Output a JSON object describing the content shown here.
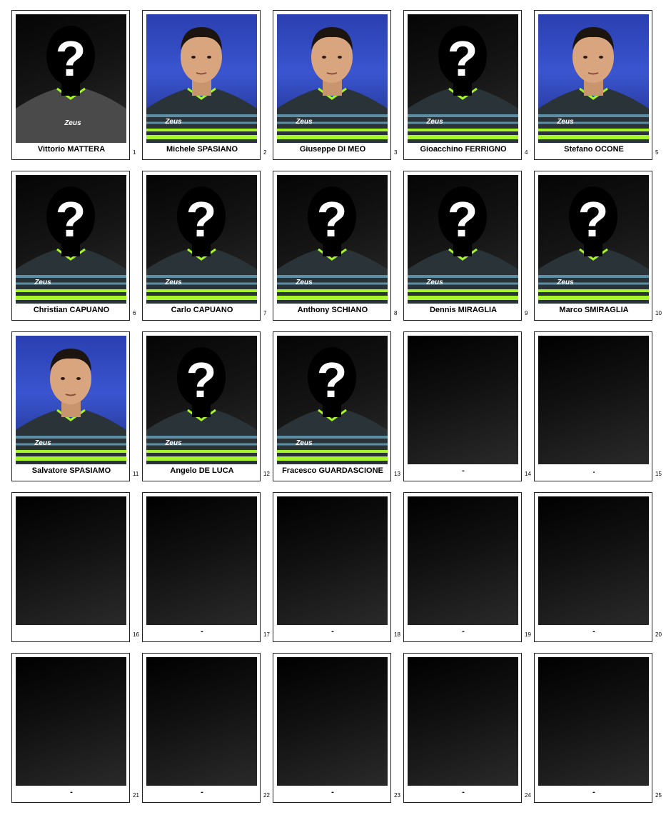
{
  "cards": [
    {
      "number": "1",
      "name": "Vittorio MATTERA",
      "photo": "silhouette-placeholder-grey-kit"
    },
    {
      "number": "2",
      "name": "Michele SPASIANO",
      "photo": "player-portrait"
    },
    {
      "number": "3",
      "name": "Giuseppe DI MEO",
      "photo": "player-portrait"
    },
    {
      "number": "4",
      "name": "Gioacchino FERRIGNO",
      "photo": "silhouette-placeholder"
    },
    {
      "number": "5",
      "name": "Stefano OCONE",
      "photo": "player-portrait"
    },
    {
      "number": "6",
      "name": "Christian CAPUANO",
      "photo": "silhouette-placeholder"
    },
    {
      "number": "7",
      "name": "Carlo CAPUANO",
      "photo": "silhouette-placeholder"
    },
    {
      "number": "8",
      "name": "Anthony SCHIANO",
      "photo": "silhouette-placeholder"
    },
    {
      "number": "9",
      "name": "Dennis MIRAGLIA",
      "photo": "silhouette-placeholder"
    },
    {
      "number": "10",
      "name": "Marco SMIRAGLIA",
      "photo": "silhouette-placeholder"
    },
    {
      "number": "11",
      "name": "Salvatore SPASIAMO",
      "photo": "player-portrait"
    },
    {
      "number": "12",
      "name": "Angelo DE LUCA",
      "photo": "silhouette-placeholder"
    },
    {
      "number": "13",
      "name": "Fracesco GUARDASCIONE",
      "photo": "silhouette-placeholder"
    },
    {
      "number": "14",
      "name": "-",
      "photo": "empty"
    },
    {
      "number": "15",
      "name": ".",
      "photo": "empty"
    },
    {
      "number": "16",
      "name": "",
      "photo": "empty"
    },
    {
      "number": "17",
      "name": "-",
      "photo": "empty"
    },
    {
      "number": "18",
      "name": "-",
      "photo": "empty"
    },
    {
      "number": "19",
      "name": "-",
      "photo": "empty"
    },
    {
      "number": "20",
      "name": "-",
      "photo": "empty"
    },
    {
      "number": "21",
      "name": "-",
      "photo": "empty"
    },
    {
      "number": "22",
      "name": "-",
      "photo": "empty"
    },
    {
      "number": "23",
      "name": "-",
      "photo": "empty"
    },
    {
      "number": "24",
      "name": "-",
      "photo": "empty"
    },
    {
      "number": "25",
      "name": "-",
      "photo": "empty"
    }
  ],
  "kit_text": "Zeus",
  "colors": {
    "accent_green": "#a6f52a",
    "kit_stripe": "#5c8fa6",
    "backdrop_blue": "#3a55d0"
  }
}
